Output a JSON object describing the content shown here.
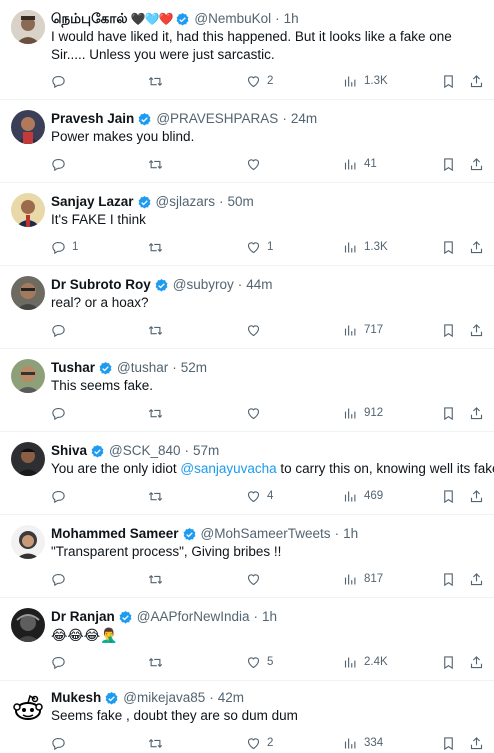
{
  "tweets": [
    {
      "name": "நெம்புகோல்",
      "name_suffix": "🖤🩵❤️",
      "verified": true,
      "handle": "@NembuKol",
      "time": "1h",
      "text": "I would have liked it, had this happened. But it looks like a fake one Sir..... Unless you were just sarcastic.",
      "replies": "",
      "retweets": "",
      "likes": "2",
      "views": "1.3K"
    },
    {
      "name": "Pravesh Jain",
      "verified": true,
      "handle": "@PRAVESHPARAS",
      "time": "24m",
      "text": "Power makes you blind.",
      "replies": "",
      "retweets": "",
      "likes": "",
      "views": "41"
    },
    {
      "name": "Sanjay Lazar",
      "verified": true,
      "handle": "@sjlazars",
      "time": "50m",
      "text": "It's FAKE I think",
      "replies": "1",
      "retweets": "",
      "likes": "1",
      "views": "1.3K"
    },
    {
      "name": "Dr Subroto Roy",
      "verified": true,
      "handle": "@subyroy",
      "time": "44m",
      "text": "real? or a hoax?",
      "replies": "",
      "retweets": "",
      "likes": "",
      "views": "717"
    },
    {
      "name": "Tushar",
      "verified": true,
      "handle": "@tushar",
      "time": "52m",
      "text": "This seems fake.",
      "replies": "",
      "retweets": "",
      "likes": "",
      "views": "912"
    },
    {
      "name": "Shiva",
      "verified": true,
      "handle": "@SCK_840",
      "time": "57m",
      "text_before": "You are the only idiot ",
      "text_mention": "@sanjayuvacha",
      "text_after": " to carry this on, knowing well its fake.",
      "replies": "",
      "retweets": "",
      "likes": "4",
      "views": "469"
    },
    {
      "name": "Mohammed Sameer",
      "verified": true,
      "handle": "@MohSameerTweets",
      "time": "1h",
      "text": "\"Transparent process\", Giving bribes !!",
      "replies": "",
      "retweets": "",
      "likes": "",
      "views": "817"
    },
    {
      "name": "Dr Ranjan",
      "verified": true,
      "handle": "@AAPforNewIndia",
      "time": "1h",
      "text": "😂😂😂🤦‍♂️",
      "replies": "",
      "retweets": "",
      "likes": "5",
      "views": "2.4K"
    },
    {
      "name": "Mukesh",
      "verified": true,
      "handle": "@mikejava85",
      "time": "42m",
      "text": "Seems fake , doubt they are so dum dum",
      "replies": "",
      "retweets": "",
      "likes": "2",
      "views": "334"
    }
  ],
  "separator": "·",
  "colors": {
    "accent": "#1d9bf0",
    "muted": "#536471",
    "text": "#0f1419",
    "divider": "#eff3f4"
  },
  "icons": [
    "reply-icon",
    "retweet-icon",
    "like-icon",
    "views-icon",
    "bookmark-icon",
    "share-icon",
    "verified-badge-icon"
  ]
}
